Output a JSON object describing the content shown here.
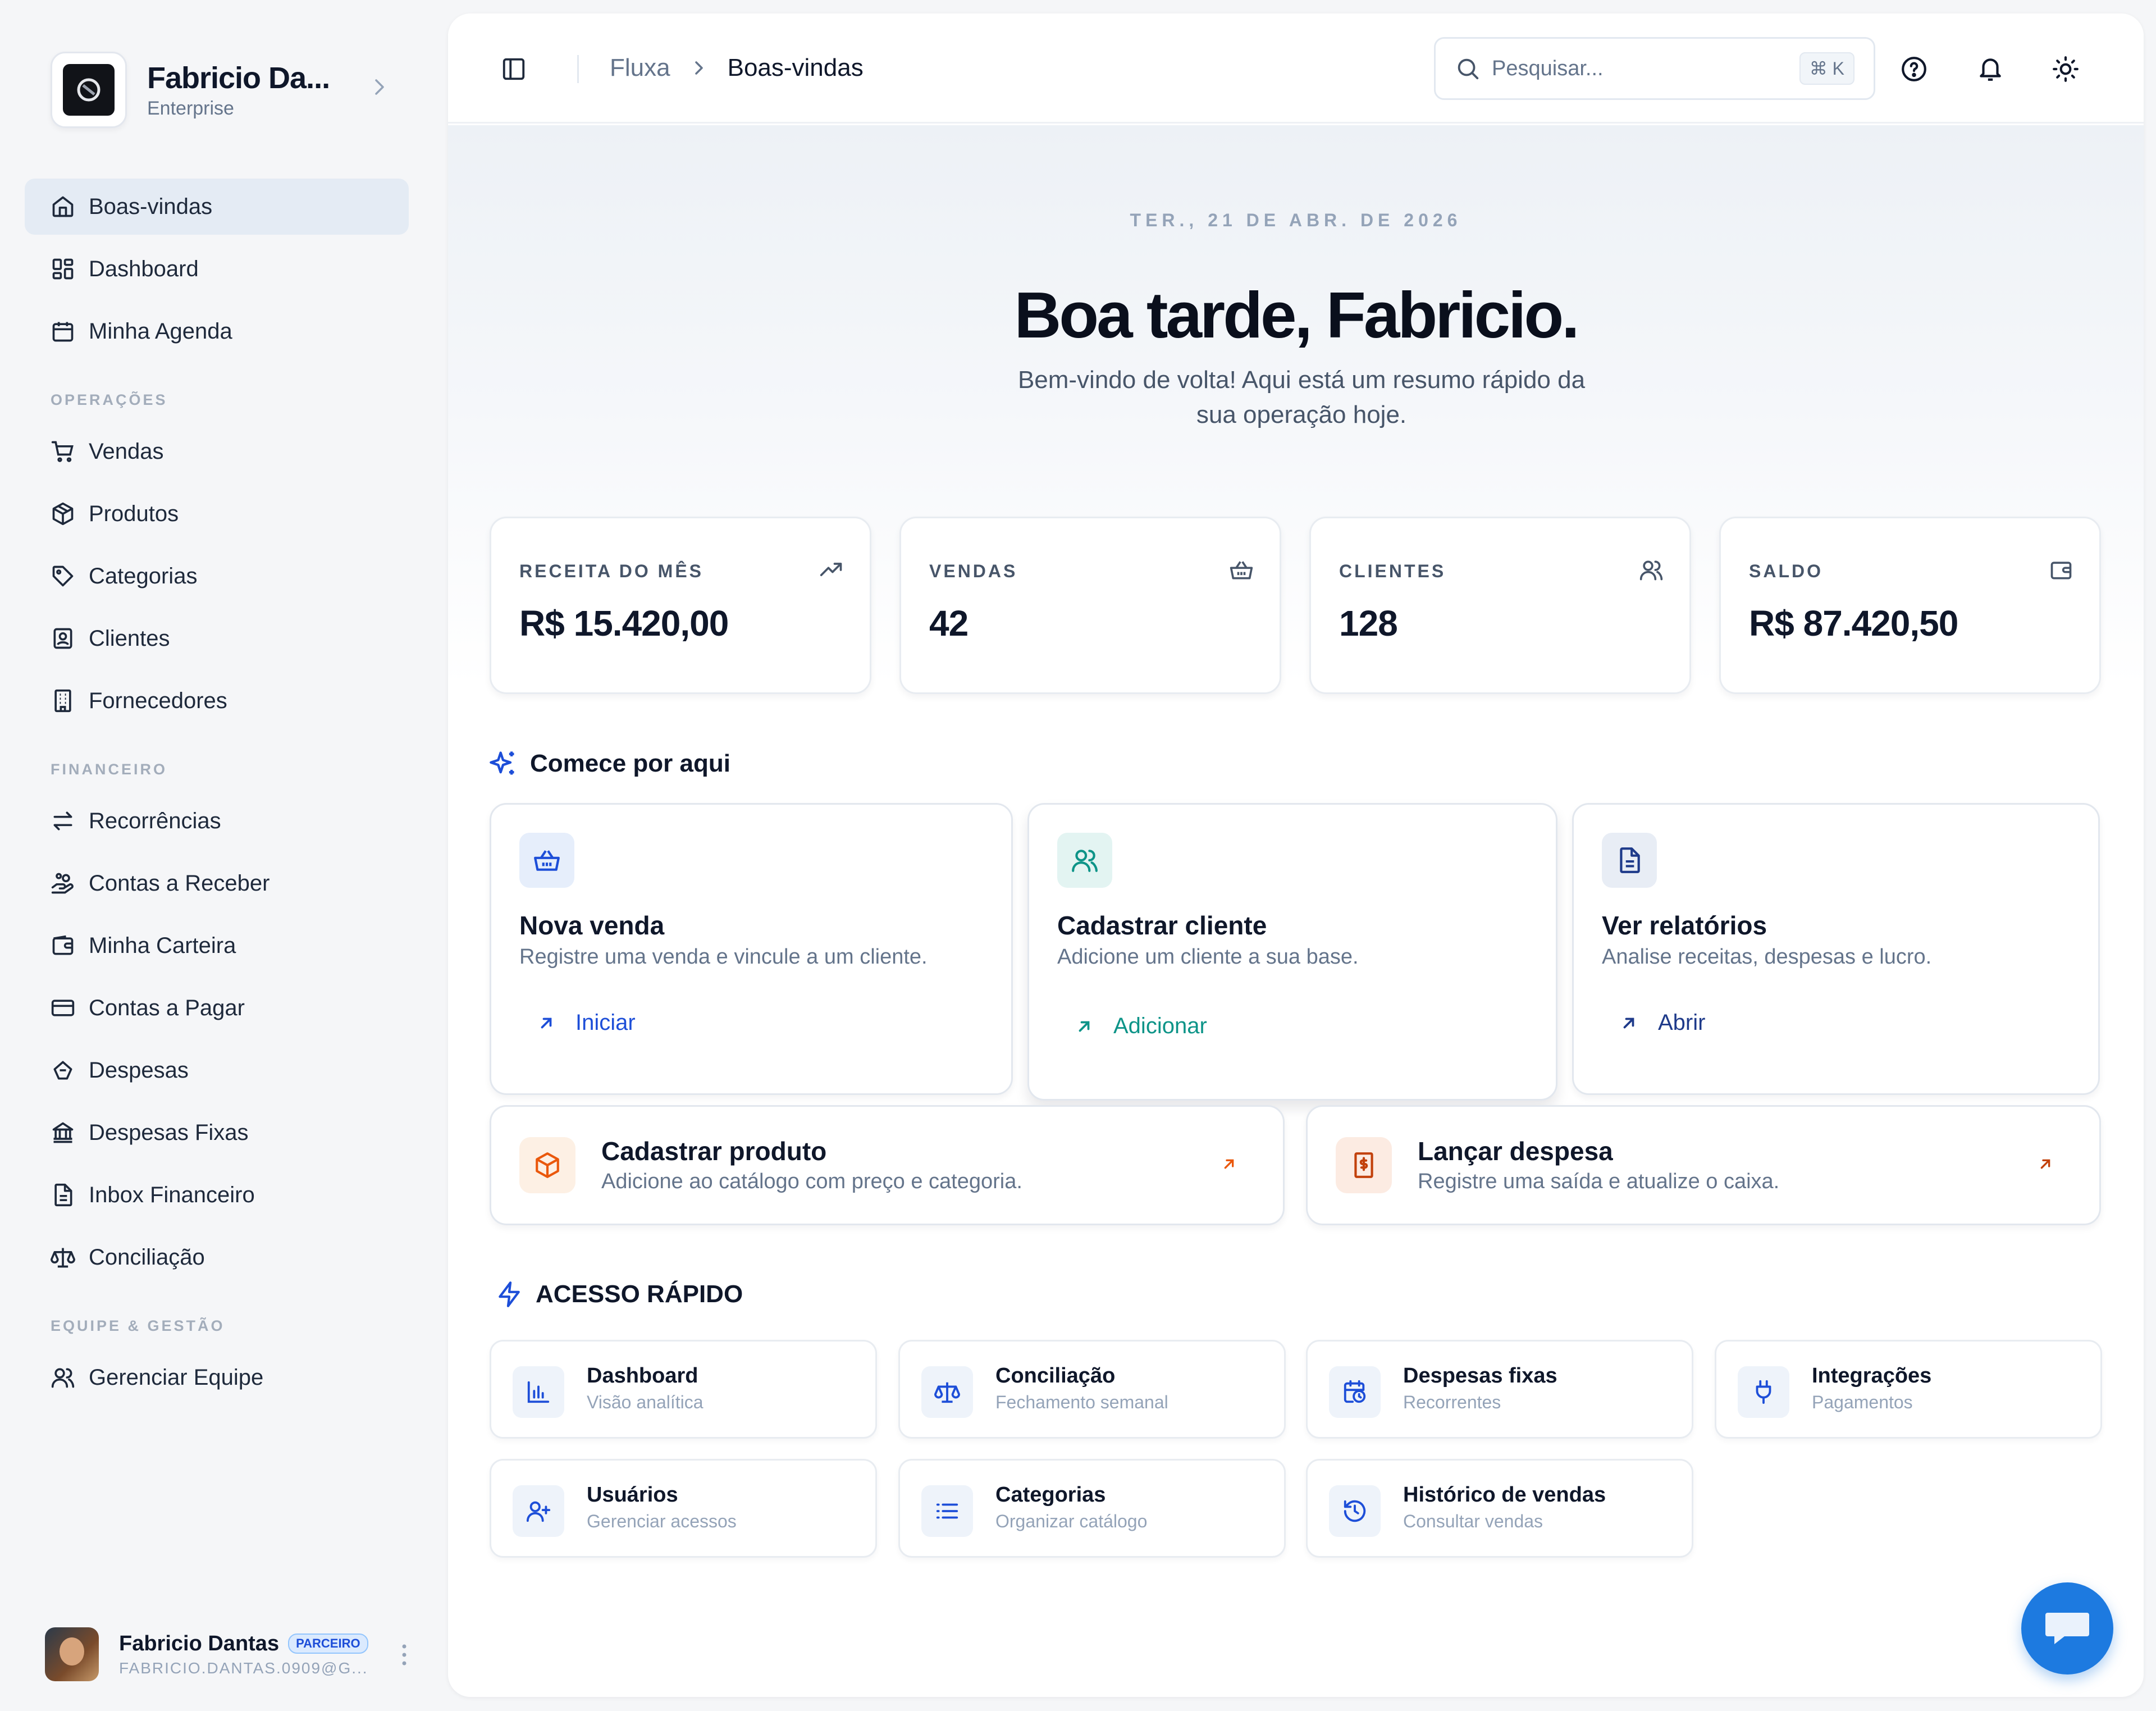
{
  "brand": {
    "name": "Fabricio Da...",
    "plan": "Enterprise"
  },
  "nav": {
    "main": [
      {
        "label": "Boas-vindas",
        "icon": "home-icon",
        "active": true
      },
      {
        "label": "Dashboard",
        "icon": "dashboard-icon"
      },
      {
        "label": "Minha Agenda",
        "icon": "calendar-icon"
      }
    ],
    "sections": [
      {
        "title": "OPERAÇÕES",
        "items": [
          {
            "label": "Vendas",
            "icon": "cart-icon"
          },
          {
            "label": "Produtos",
            "icon": "package-icon"
          },
          {
            "label": "Categorias",
            "icon": "tag-icon"
          },
          {
            "label": "Clientes",
            "icon": "contact-icon"
          },
          {
            "label": "Fornecedores",
            "icon": "building-icon"
          }
        ]
      },
      {
        "title": "FINANCEIRO",
        "items": [
          {
            "label": "Recorrências",
            "icon": "repeat-icon"
          },
          {
            "label": "Contas a Receber",
            "icon": "hand-coins-icon"
          },
          {
            "label": "Minha Carteira",
            "icon": "wallet-icon"
          },
          {
            "label": "Contas a Pagar",
            "icon": "credit-card-icon"
          },
          {
            "label": "Despesas",
            "icon": "receipt-icon"
          },
          {
            "label": "Despesas Fixas",
            "icon": "bank-icon"
          },
          {
            "label": "Inbox Financeiro",
            "icon": "file-text-icon"
          },
          {
            "label": "Conciliação",
            "icon": "scale-icon"
          }
        ]
      },
      {
        "title": "EQUIPE & GESTÃO",
        "items": [
          {
            "label": "Gerenciar Equipe",
            "icon": "users-icon"
          }
        ]
      }
    ]
  },
  "profile": {
    "name": "Fabricio Dantas",
    "badge": "PARCEIRO",
    "email": "FABRICIO.DANTAS.0909@G..."
  },
  "topbar": {
    "breadcrumb": {
      "root": "Fluxa",
      "current": "Boas-vindas"
    },
    "search_placeholder": "Pesquisar...",
    "shortcut": "⌘ K"
  },
  "hero": {
    "date": "TER., 21 DE ABR. DE 2026",
    "greeting": "Boa tarde, Fabricio.",
    "subtitle": "Bem-vindo de volta! Aqui está um resumo rápido da sua operação hoje."
  },
  "stats": [
    {
      "label": "RECEITA DO MÊS",
      "value": "R$ 15.420,00",
      "icon": "trending-up-icon"
    },
    {
      "label": "VENDAS",
      "value": "42",
      "icon": "basket-icon"
    },
    {
      "label": "CLIENTES",
      "value": "128",
      "icon": "users-icon"
    },
    {
      "label": "SALDO",
      "value": "R$ 87.420,50",
      "icon": "wallet-icon"
    }
  ],
  "start": {
    "title": "Comece por aqui",
    "cards": [
      {
        "title": "Nova venda",
        "desc": "Registre uma venda e vincule a um cliente.",
        "link": "Iniciar",
        "color": "#1d4ed8"
      },
      {
        "title": "Cadastrar cliente",
        "desc": "Adicione um cliente a sua base.",
        "link": "Adicionar",
        "color": "#0d9488"
      },
      {
        "title": "Ver relatórios",
        "desc": "Analise receitas, despesas e lucro.",
        "link": "Abrir",
        "color": "#1e3a8a"
      }
    ],
    "wide": [
      {
        "title": "Cadastrar produto",
        "desc": "Adicione ao catálogo com preço e categoria.",
        "color": "#ea580c"
      },
      {
        "title": "Lançar despesa",
        "desc": "Registre uma saída e atualize o caixa.",
        "color": "#c2410c"
      }
    ]
  },
  "quick": {
    "title": "ACESSO RÁPIDO",
    "items": [
      {
        "title": "Dashboard",
        "sub": "Visão analítica",
        "icon": "bar-chart-icon"
      },
      {
        "title": "Conciliação",
        "sub": "Fechamento semanal",
        "icon": "scale-icon"
      },
      {
        "title": "Despesas fixas",
        "sub": "Recorrentes",
        "icon": "calendar-clock-icon"
      },
      {
        "title": "Integrações",
        "sub": "Pagamentos",
        "icon": "plug-icon"
      },
      {
        "title": "Usuários",
        "sub": "Gerenciar acessos",
        "icon": "user-plus-icon"
      },
      {
        "title": "Categorias",
        "sub": "Organizar catálogo",
        "icon": "list-icon"
      },
      {
        "title": "Histórico de vendas",
        "sub": "Consultar vendas",
        "icon": "history-icon"
      }
    ]
  },
  "colors": {
    "accent": "#1d7ae0",
    "active_nav": "#e4ebf4"
  }
}
